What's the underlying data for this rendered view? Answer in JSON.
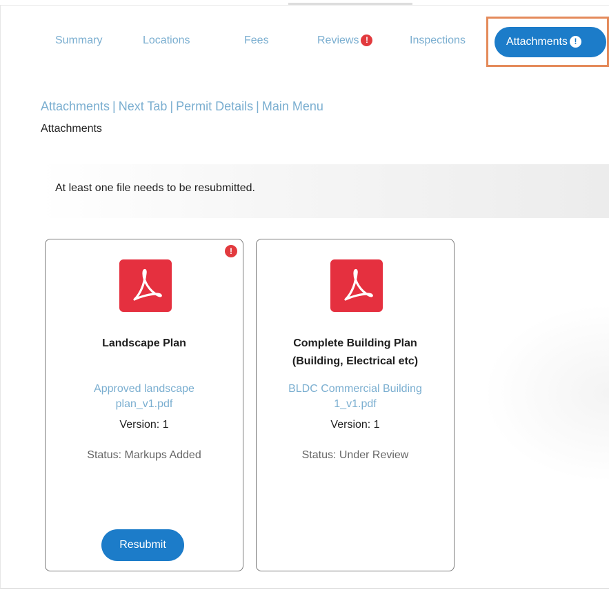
{
  "tabs": {
    "summary": "Summary",
    "locations": "Locations",
    "fees": "Fees",
    "reviews": "Reviews",
    "reviews_badge": "!",
    "inspections": "Inspections",
    "attachments": "Attachments",
    "attachments_badge": "!"
  },
  "breadcrumb": {
    "items": [
      "Attachments",
      "Next Tab",
      "Permit Details",
      "Main Menu"
    ],
    "separator": "|"
  },
  "page_title": "Attachments",
  "notice": "At least one file needs to be resubmitted.",
  "cards": [
    {
      "icon": "pdf-icon",
      "alert": "!",
      "title_lines": [
        "Landscape Plan"
      ],
      "file_lines": [
        "Approved landscape",
        "plan_v1.pdf"
      ],
      "version": "Version: 1",
      "status": "Status: Markups Added",
      "action": "Resubmit"
    },
    {
      "icon": "pdf-icon",
      "title_lines": [
        "Complete Building Plan",
        "(Building, Electrical etc)"
      ],
      "file_lines": [
        "BLDC Commercial Building",
        "1_v1.pdf"
      ],
      "version": "Version: 1",
      "status": "Status: Under Review"
    }
  ],
  "colors": {
    "link": "#7aaed0",
    "primary": "#1c7cc9",
    "alert": "#e23a3e",
    "pdf": "#e5303f",
    "highlight": "#e48a5a"
  }
}
